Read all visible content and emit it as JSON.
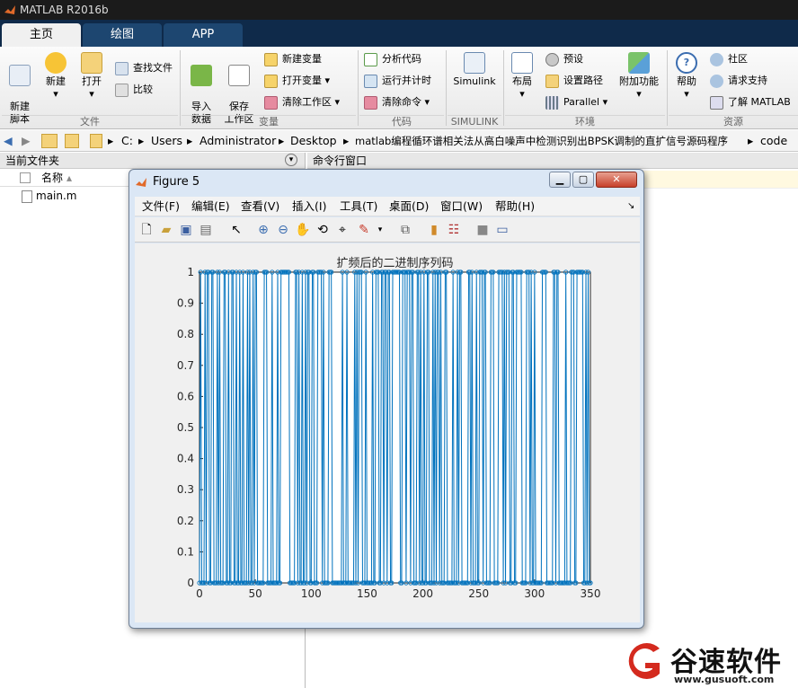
{
  "app": {
    "title": "MATLAB R2016b"
  },
  "tabs": [
    "主页",
    "绘图",
    "APP"
  ],
  "ribbon": {
    "file": {
      "new_script": "新建\n脚本",
      "new": "新建",
      "open": "打开",
      "find_files": "查找文件",
      "compare": "比较",
      "group": "文件"
    },
    "variable": {
      "import": "导入\n数据",
      "save_ws": "保存\n工作区",
      "new_var": "新建变量",
      "open_var": "打开变量",
      "clear_ws": "清除工作区",
      "group": "变量"
    },
    "code": {
      "analyze": "分析代码",
      "run_time": "运行并计时",
      "clear_cmd": "清除命令",
      "group": "代码"
    },
    "simulink": {
      "label": "Simulink",
      "group": "SIMULINK"
    },
    "env": {
      "layout": "布局",
      "prefs": "预设",
      "set_path": "设置路径",
      "parallel": "Parallel",
      "addons": "附加功能",
      "group": "环境"
    },
    "resources": {
      "help": "帮助",
      "community": "社区",
      "support": "请求支持",
      "learn": "了解 MATLAB",
      "group": "资源"
    }
  },
  "address": [
    "C:",
    "Users",
    "Administrator",
    "Desktop",
    "matlab编程循环谱相关法从高白噪声中检测识别出BPSK调制的直扩信号源码程序",
    "code"
  ],
  "left_panel": {
    "title": "当前文件夹",
    "col_name": "名称",
    "files": [
      "main.m"
    ]
  },
  "right_panel": {
    "title": "命令行窗口"
  },
  "figure": {
    "title": "Figure 5",
    "menus": [
      "文件(F)",
      "编辑(E)",
      "查看(V)",
      "插入(I)",
      "工具(T)",
      "桌面(D)",
      "窗口(W)",
      "帮助(H)"
    ]
  },
  "chart_data": {
    "type": "line",
    "title": "扩频后的二进制序列码",
    "xlabel": "",
    "ylabel": "",
    "xlim": [
      0,
      350
    ],
    "ylim": [
      0,
      1
    ],
    "xticks": [
      0,
      50,
      100,
      150,
      200,
      250,
      300,
      350
    ],
    "yticks": [
      0,
      0.1,
      0.2,
      0.3,
      0.4,
      0.5,
      0.6,
      0.7,
      0.8,
      0.9,
      1
    ],
    "n_points": 350,
    "values_levels": [
      0,
      1
    ],
    "marker": "o",
    "color": "#0072bd",
    "seed": 7
  },
  "watermark": {
    "brand": "谷速软件",
    "url": "www.gusuoft.com"
  },
  "colors": {
    "accent": "#0072bd",
    "tabbar": "#0f2a4a"
  }
}
